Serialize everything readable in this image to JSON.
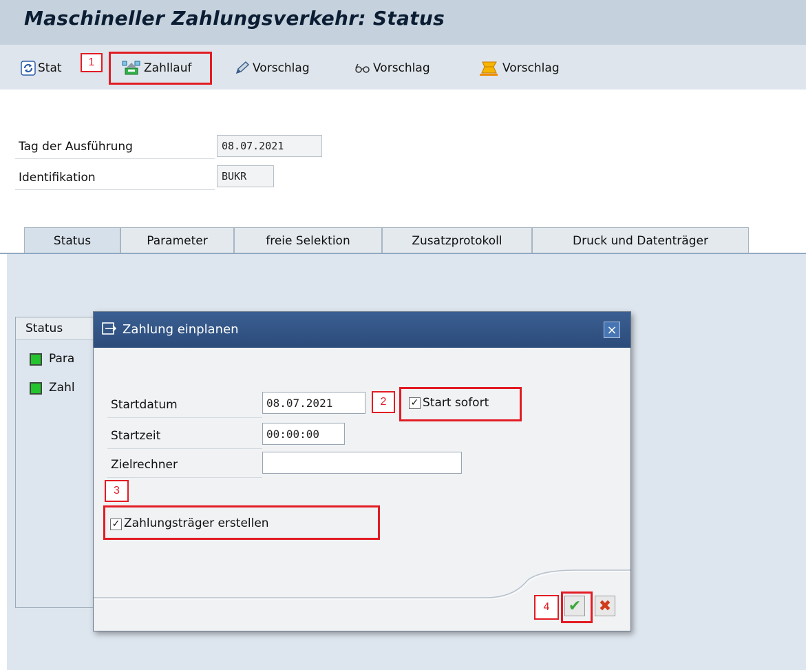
{
  "title": "Maschineller Zahlungsverkehr: Status",
  "toolbar": {
    "status_label": "Stat",
    "zahllauf_label": "Zahllauf",
    "vorschlag_edit_label": "Vorschlag",
    "vorschlag_display_label": "Vorschlag",
    "vorschlag_delete_label": "Vorschlag"
  },
  "form": {
    "run_date_label": "Tag der Ausführung",
    "run_date_value": "08.07.2021",
    "identification_label": "Identifikation",
    "identification_value": "BUKR"
  },
  "tabs": [
    {
      "label": "Status"
    },
    {
      "label": "Parameter"
    },
    {
      "label": "freie Selektion"
    },
    {
      "label": "Zusatzprotokoll"
    },
    {
      "label": "Druck und Datenträger"
    }
  ],
  "status_panel": {
    "header": "Status",
    "items": [
      {
        "label": "Para"
      },
      {
        "label": "Zahl"
      }
    ]
  },
  "dialog": {
    "title": "Zahlung einplanen",
    "close_label": "×",
    "start_date_label": "Startdatum",
    "start_date_value": "08.07.2021",
    "start_time_label": "Startzeit",
    "start_time_value": "00:00:00",
    "target_host_label": "Zielrechner",
    "target_host_value": "",
    "start_now_label": "Start sofort",
    "start_now_checked": true,
    "create_media_label": "Zahlungsträger erstellen",
    "create_media_checked": true,
    "confirm_icon": "✔",
    "cancel_icon": "✖"
  },
  "annotations": {
    "tag1": "1",
    "tag2": "2",
    "tag3": "3",
    "tag4": "4",
    "highlight_color": "#e31b23"
  },
  "colors": {
    "title_bar": "#c5d1dc",
    "dialog_header": "#2b4b7a",
    "status_green": "#23c42e"
  }
}
